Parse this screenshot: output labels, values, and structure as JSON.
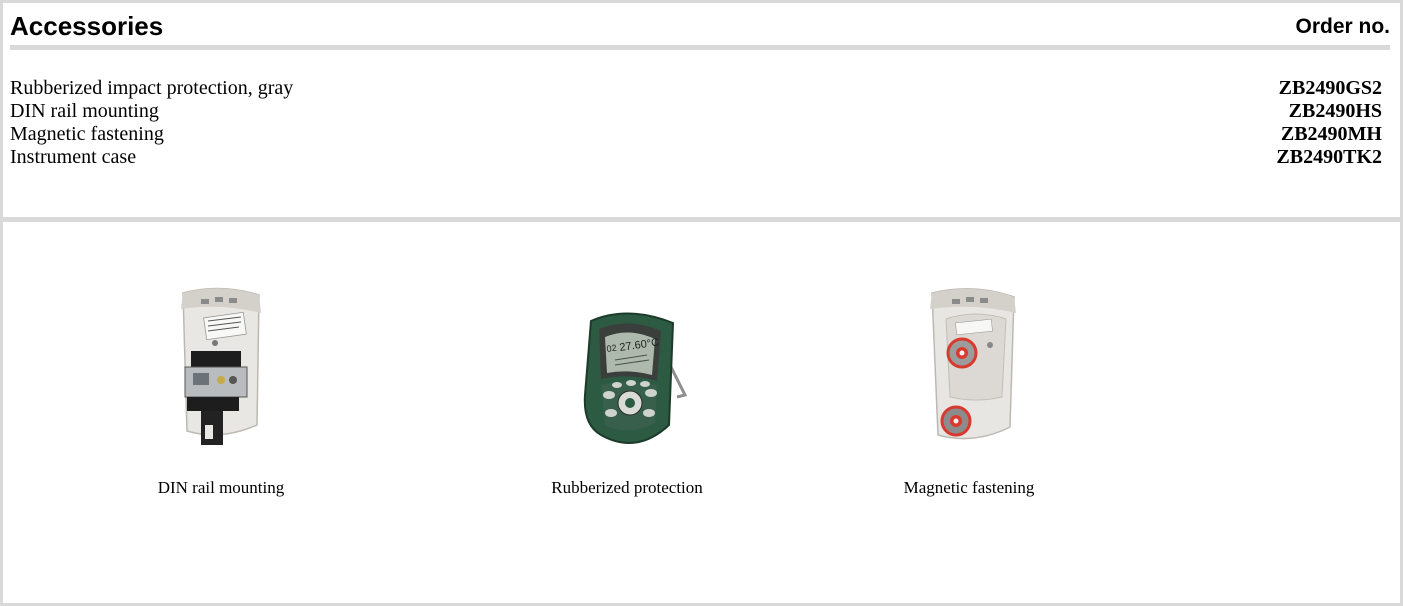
{
  "header": {
    "title": "Accessories",
    "order_label": "Order no."
  },
  "items": [
    {
      "name": "Rubberized impact protection, gray",
      "code": "ZB2490GS2"
    },
    {
      "name": "DIN rail mounting",
      "code": "ZB2490HS"
    },
    {
      "name": "Magnetic fastening",
      "code": "ZB2490MH"
    },
    {
      "name": "Instrument case",
      "code": "ZB2490TK2"
    }
  ],
  "figures": [
    {
      "caption": "DIN rail mounting",
      "image": "din-rail-device-photo"
    },
    {
      "caption": "Rubberized protection",
      "image": "rubberized-device-photo",
      "screen_text": {
        "line1": "02",
        "reading": "27.60°C"
      }
    },
    {
      "caption": "Magnetic fastening",
      "image": "magnetic-device-photo"
    }
  ],
  "colors": {
    "border": "#d9d9d9",
    "device_body": "#e8e6e2",
    "rubber_green": "#2c5a43",
    "lcd": "#aeb9ad",
    "magnet_red": "#d83a2e"
  }
}
